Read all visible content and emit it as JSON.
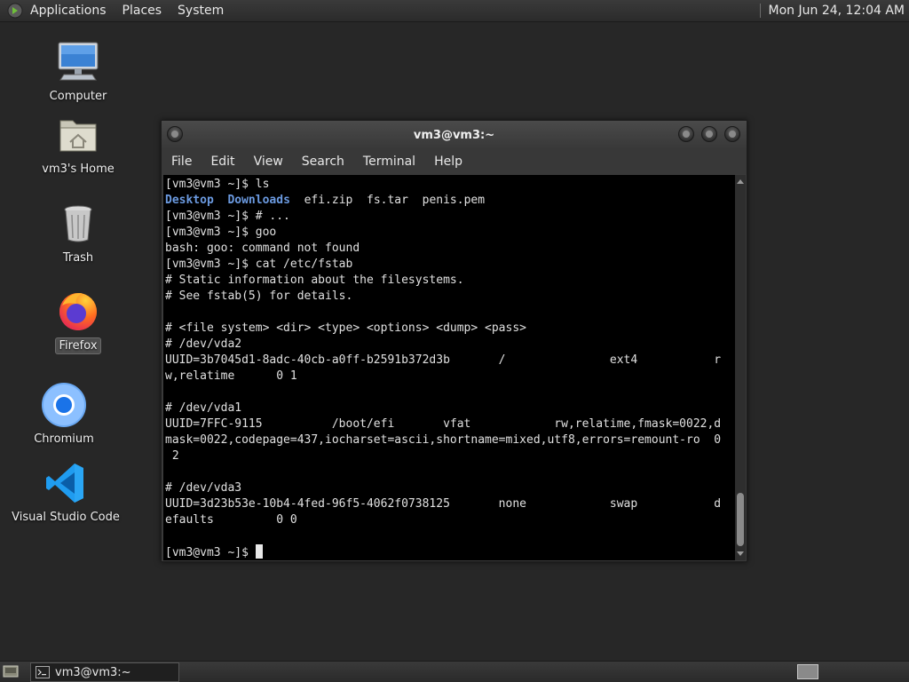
{
  "top_panel": {
    "menus": [
      "Applications",
      "Places",
      "System"
    ],
    "clock": "Mon Jun 24, 12:04 AM"
  },
  "desktop": {
    "icons": [
      {
        "label": "Computer",
        "icon": "computer-icon"
      },
      {
        "label": "vm3's Home",
        "icon": "home-folder-icon"
      },
      {
        "label": "Trash",
        "icon": "trash-icon"
      },
      {
        "label": "Firefox",
        "icon": "firefox-icon"
      },
      {
        "label": "Chromium",
        "icon": "chromium-icon"
      },
      {
        "label": "Visual Studio Code",
        "icon": "vscode-icon"
      }
    ]
  },
  "window": {
    "title": "vm3@vm3:~",
    "menus": [
      "File",
      "Edit",
      "View",
      "Search",
      "Terminal",
      "Help"
    ]
  },
  "terminal": {
    "lines": [
      "[vm3@vm3 ~]$ ls",
      "__LS__",
      "[vm3@vm3 ~]$ # ...",
      "[vm3@vm3 ~]$ goo",
      "bash: goo: command not found",
      "[vm3@vm3 ~]$ cat /etc/fstab",
      "# Static information about the filesystems.",
      "# See fstab(5) for details.",
      "",
      "# <file system> <dir> <type> <options> <dump> <pass>",
      "# /dev/vda2",
      "UUID=3b7045d1-8adc-40cb-a0ff-b2591b372d3b       /               ext4           r",
      "w,relatime      0 1",
      "",
      "# /dev/vda1",
      "UUID=7FFC-9115          /boot/efi       vfat            rw,relatime,fmask=0022,d",
      "mask=0022,codepage=437,iocharset=ascii,shortname=mixed,utf8,errors=remount-ro  0",
      " 2",
      "",
      "# /dev/vda3",
      "UUID=3d23b53e-10b4-4fed-96f5-4062f0738125       none            swap           d",
      "efaults         0 0",
      "",
      "[vm3@vm3 ~]$ "
    ],
    "ls_output": {
      "dirs": [
        "Desktop",
        "Downloads"
      ],
      "files": "efi.zip  fs.tar  penis.pem"
    }
  },
  "taskbar": {
    "task_label": "vm3@vm3:~"
  },
  "colors": {
    "dir": "#6b9ae0",
    "terminal_bg": "#000000",
    "desktop_bg": "#272727"
  }
}
